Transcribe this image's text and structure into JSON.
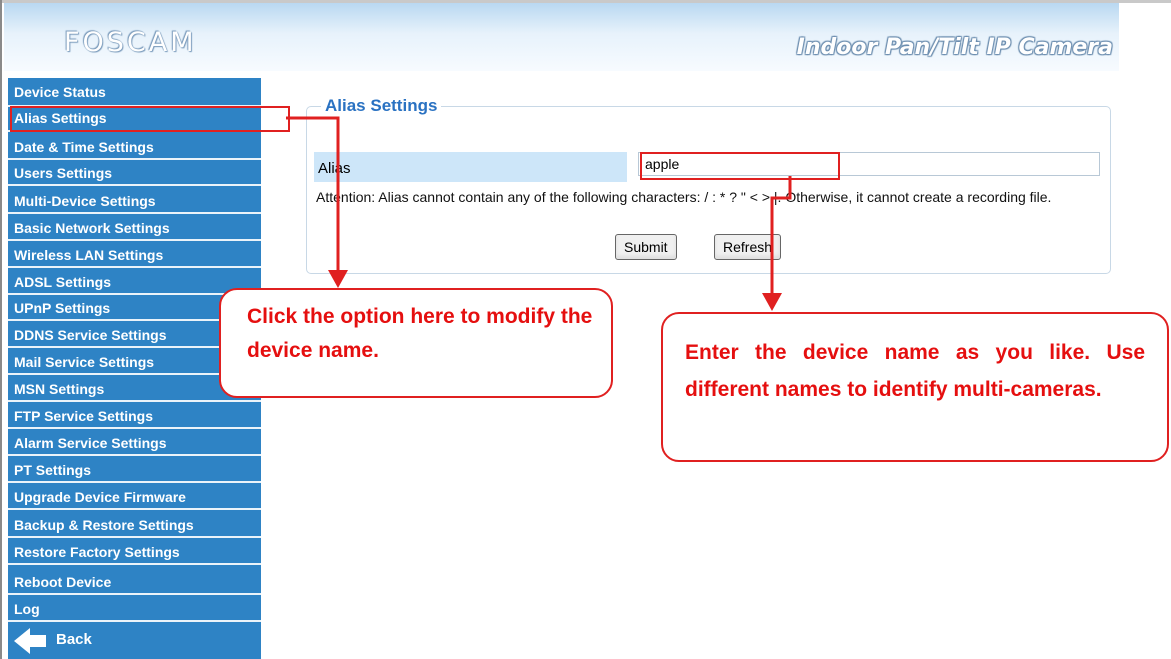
{
  "header": {
    "logo": "FOSCAM",
    "product": "Indoor Pan/Tilt IP Camera"
  },
  "sidebar": {
    "items": [
      {
        "label": "Device Status"
      },
      {
        "label": "Alias Settings"
      },
      {
        "label": "Date & Time Settings"
      },
      {
        "label": "Users Settings"
      },
      {
        "label": "Multi-Device Settings"
      },
      {
        "label": "Basic Network Settings"
      },
      {
        "label": "Wireless LAN Settings"
      },
      {
        "label": "ADSL Settings"
      },
      {
        "label": "UPnP Settings"
      },
      {
        "label": "DDNS Service Settings"
      },
      {
        "label": "Mail Service Settings"
      },
      {
        "label": "MSN Settings"
      },
      {
        "label": "FTP Service Settings"
      },
      {
        "label": "Alarm Service Settings"
      },
      {
        "label": "PT Settings"
      },
      {
        "label": "Upgrade Device Firmware"
      },
      {
        "label": "Backup & Restore Settings"
      },
      {
        "label": "Restore Factory Settings"
      },
      {
        "label": "Reboot Device"
      },
      {
        "label": "Log"
      }
    ],
    "back_label": "Back",
    "selected": "Alias Settings"
  },
  "panel": {
    "legend": "Alias Settings",
    "alias_label": "Alias",
    "alias_value": "apple",
    "attention": "Attention: Alias cannot contain any of the following characters: / : * ? \" < > |. Otherwise, it cannot create a recording file.",
    "submit_label": "Submit",
    "refresh_label": "Refresh"
  },
  "annotations": {
    "callout_left": "Click the option here to modify the device name.",
    "callout_right": "Enter the device name as you like. Use different names to identify multi-cameras."
  },
  "colors": {
    "sidebar_bg": "#2e83c5",
    "legend_text": "#2a72c2",
    "annotation_red": "#e02020"
  }
}
